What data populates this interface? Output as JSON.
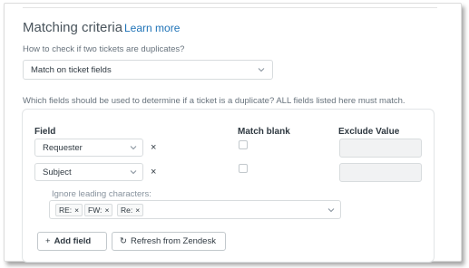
{
  "section": {
    "title": "Matching criteria",
    "learn_more": "Learn more"
  },
  "duplicate_check": {
    "question": "How to check if two tickets are duplicates?",
    "selected": "Match on ticket fields"
  },
  "fields_question": "Which fields should be used to determine if a ticket is a duplicate? ALL fields listed here must match.",
  "table": {
    "headers": {
      "field": "Field",
      "match_blank": "Match blank",
      "exclude_value": "Exclude Value"
    },
    "rows": [
      {
        "field": "Requester",
        "remove": "×",
        "match_blank": false,
        "exclude_value": ""
      },
      {
        "field": "Subject",
        "remove": "×",
        "match_blank": false,
        "exclude_value": ""
      }
    ]
  },
  "ignore": {
    "label": "Ignore leading characters:",
    "tags": [
      {
        "text": "RE:",
        "remove": "×"
      },
      {
        "text": "FW:",
        "remove": "×"
      },
      {
        "text": "Re:",
        "remove": "×"
      }
    ]
  },
  "buttons": {
    "add_field": "Add field",
    "add_icon": "+",
    "refresh": "Refresh from Zendesk",
    "refresh_icon": "↻"
  },
  "colors": {
    "link": "#1f73b7",
    "text": "#2f3941",
    "muted": "#68737d",
    "disabled_bg": "#f1f2f3"
  },
  "icons": [
    "chevron-down-icon",
    "close-icon",
    "plus-icon",
    "refresh-icon"
  ]
}
